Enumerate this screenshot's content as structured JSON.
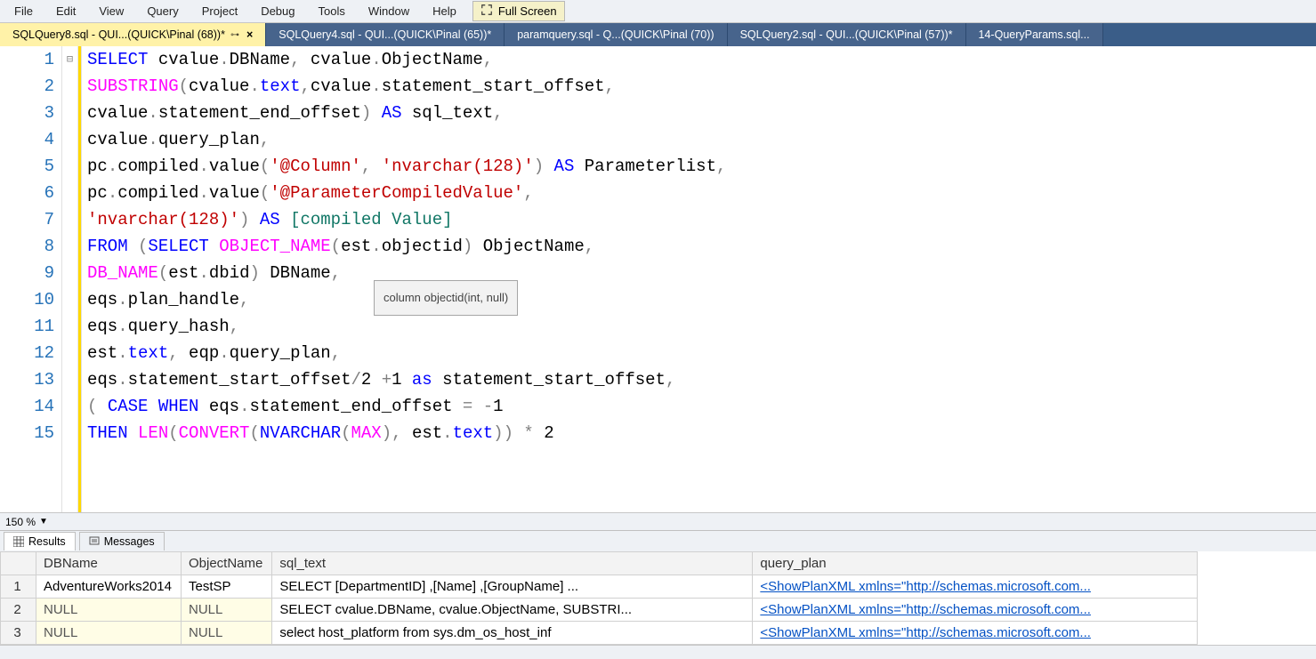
{
  "menubar": {
    "items": [
      "File",
      "Edit",
      "View",
      "Query",
      "Project",
      "Debug",
      "Tools",
      "Window",
      "Help"
    ],
    "fullscreen_label": "Full Screen"
  },
  "tabs": [
    {
      "label": "SQLQuery8.sql - QUI...(QUICK\\Pinal (68))*",
      "active": true,
      "pinned": true,
      "closable": true
    },
    {
      "label": "SQLQuery4.sql - QUI...(QUICK\\Pinal (65))*",
      "active": false,
      "pinned": false,
      "closable": false
    },
    {
      "label": "paramquery.sql - Q...(QUICK\\Pinal (70))",
      "active": false,
      "pinned": false,
      "closable": false
    },
    {
      "label": "SQLQuery2.sql - QUI...(QUICK\\Pinal (57))*",
      "active": false,
      "pinned": false,
      "closable": false
    },
    {
      "label": "14-QueryParams.sql...",
      "active": false,
      "pinned": false,
      "closable": false
    }
  ],
  "code_lines": [
    {
      "n": 1,
      "tokens": [
        {
          "t": "SELECT ",
          "c": "kw"
        },
        {
          "t": "cvalue",
          "c": "id"
        },
        {
          "t": ".",
          "c": "op"
        },
        {
          "t": "DBName",
          "c": "id"
        },
        {
          "t": ", ",
          "c": "op"
        },
        {
          "t": "cvalue",
          "c": "id"
        },
        {
          "t": ".",
          "c": "op"
        },
        {
          "t": "ObjectName",
          "c": "id"
        },
        {
          "t": ",",
          "c": "op"
        }
      ]
    },
    {
      "n": 2,
      "tokens": [
        {
          "t": "SUBSTRING",
          "c": "fn"
        },
        {
          "t": "(",
          "c": "op"
        },
        {
          "t": "cvalue",
          "c": "id"
        },
        {
          "t": ".",
          "c": "op"
        },
        {
          "t": "text",
          "c": "kw"
        },
        {
          "t": ",",
          "c": "op"
        },
        {
          "t": "cvalue",
          "c": "id"
        },
        {
          "t": ".",
          "c": "op"
        },
        {
          "t": "statement_start_offset",
          "c": "id"
        },
        {
          "t": ",",
          "c": "op"
        }
      ]
    },
    {
      "n": 3,
      "tokens": [
        {
          "t": "cvalue",
          "c": "id"
        },
        {
          "t": ".",
          "c": "op"
        },
        {
          "t": "statement_end_offset",
          "c": "id"
        },
        {
          "t": ") ",
          "c": "op"
        },
        {
          "t": "AS",
          "c": "kw"
        },
        {
          "t": " sql_text",
          "c": "id"
        },
        {
          "t": ",",
          "c": "op"
        }
      ]
    },
    {
      "n": 4,
      "tokens": [
        {
          "t": "cvalue",
          "c": "id"
        },
        {
          "t": ".",
          "c": "op"
        },
        {
          "t": "query_plan",
          "c": "id"
        },
        {
          "t": ",",
          "c": "op"
        }
      ]
    },
    {
      "n": 5,
      "tokens": [
        {
          "t": "pc",
          "c": "id"
        },
        {
          "t": ".",
          "c": "op"
        },
        {
          "t": "compiled",
          "c": "id"
        },
        {
          "t": ".",
          "c": "op"
        },
        {
          "t": "value",
          "c": "id"
        },
        {
          "t": "(",
          "c": "op"
        },
        {
          "t": "'@Column'",
          "c": "str"
        },
        {
          "t": ", ",
          "c": "op"
        },
        {
          "t": "'nvarchar(128)'",
          "c": "str"
        },
        {
          "t": ") ",
          "c": "op"
        },
        {
          "t": "AS",
          "c": "kw"
        },
        {
          "t": " Parameterlist",
          "c": "id"
        },
        {
          "t": ",",
          "c": "op"
        }
      ]
    },
    {
      "n": 6,
      "tokens": [
        {
          "t": "pc",
          "c": "id"
        },
        {
          "t": ".",
          "c": "op"
        },
        {
          "t": "compiled",
          "c": "id"
        },
        {
          "t": ".",
          "c": "op"
        },
        {
          "t": "value",
          "c": "id"
        },
        {
          "t": "(",
          "c": "op"
        },
        {
          "t": "'@ParameterCompiledValue'",
          "c": "str"
        },
        {
          "t": ",",
          "c": "op"
        }
      ]
    },
    {
      "n": 7,
      "tokens": [
        {
          "t": "'nvarchar(128)'",
          "c": "str"
        },
        {
          "t": ") ",
          "c": "op"
        },
        {
          "t": "AS",
          "c": "kw"
        },
        {
          "t": " ",
          "c": "id"
        },
        {
          "t": "[compiled Value]",
          "c": "teal"
        }
      ]
    },
    {
      "n": 8,
      "tokens": [
        {
          "t": "FROM ",
          "c": "kw"
        },
        {
          "t": "(",
          "c": "op"
        },
        {
          "t": "SELECT ",
          "c": "kw"
        },
        {
          "t": "OBJECT_NAME",
          "c": "fn"
        },
        {
          "t": "(",
          "c": "op"
        },
        {
          "t": "est",
          "c": "id"
        },
        {
          "t": ".",
          "c": "op"
        },
        {
          "t": "objectid",
          "c": "id"
        },
        {
          "t": ") ",
          "c": "op"
        },
        {
          "t": "ObjectName",
          "c": "id"
        },
        {
          "t": ",",
          "c": "op"
        }
      ]
    },
    {
      "n": 9,
      "tokens": [
        {
          "t": "DB_NAME",
          "c": "fn"
        },
        {
          "t": "(",
          "c": "op"
        },
        {
          "t": "est",
          "c": "id"
        },
        {
          "t": ".",
          "c": "op"
        },
        {
          "t": "dbid",
          "c": "id"
        },
        {
          "t": ") ",
          "c": "op"
        },
        {
          "t": "DBName",
          "c": "id"
        },
        {
          "t": ",",
          "c": "op"
        }
      ]
    },
    {
      "n": 10,
      "tokens": [
        {
          "t": "eqs",
          "c": "id"
        },
        {
          "t": ".",
          "c": "op"
        },
        {
          "t": "plan_handle",
          "c": "id"
        },
        {
          "t": ",",
          "c": "op"
        }
      ]
    },
    {
      "n": 11,
      "tokens": [
        {
          "t": "eqs",
          "c": "id"
        },
        {
          "t": ".",
          "c": "op"
        },
        {
          "t": "query_hash",
          "c": "id"
        },
        {
          "t": ",",
          "c": "op"
        }
      ]
    },
    {
      "n": 12,
      "tokens": [
        {
          "t": "est",
          "c": "id"
        },
        {
          "t": ".",
          "c": "op"
        },
        {
          "t": "text",
          "c": "kw"
        },
        {
          "t": ", ",
          "c": "op"
        },
        {
          "t": "eqp",
          "c": "id"
        },
        {
          "t": ".",
          "c": "op"
        },
        {
          "t": "query_plan",
          "c": "id"
        },
        {
          "t": ",",
          "c": "op"
        }
      ]
    },
    {
      "n": 13,
      "tokens": [
        {
          "t": "eqs",
          "c": "id"
        },
        {
          "t": ".",
          "c": "op"
        },
        {
          "t": "statement_start_offset",
          "c": "id"
        },
        {
          "t": "/",
          "c": "op"
        },
        {
          "t": "2 ",
          "c": "num"
        },
        {
          "t": "+",
          "c": "op"
        },
        {
          "t": "1 ",
          "c": "num"
        },
        {
          "t": "as",
          "c": "kw"
        },
        {
          "t": " statement_start_offset",
          "c": "id"
        },
        {
          "t": ",",
          "c": "op"
        }
      ]
    },
    {
      "n": 14,
      "tokens": [
        {
          "t": "( ",
          "c": "op"
        },
        {
          "t": "CASE WHEN ",
          "c": "kw"
        },
        {
          "t": "eqs",
          "c": "id"
        },
        {
          "t": ".",
          "c": "op"
        },
        {
          "t": "statement_end_offset ",
          "c": "id"
        },
        {
          "t": "= ",
          "c": "op"
        },
        {
          "t": "-",
          "c": "op"
        },
        {
          "t": "1",
          "c": "num"
        }
      ]
    },
    {
      "n": 15,
      "tokens": [
        {
          "t": "THEN ",
          "c": "kw"
        },
        {
          "t": "LEN",
          "c": "fn"
        },
        {
          "t": "(",
          "c": "op"
        },
        {
          "t": "CONVERT",
          "c": "fn"
        },
        {
          "t": "(",
          "c": "op"
        },
        {
          "t": "NVARCHAR",
          "c": "kw"
        },
        {
          "t": "(",
          "c": "op"
        },
        {
          "t": "MAX",
          "c": "fn"
        },
        {
          "t": ")",
          "c": "op"
        },
        {
          "t": ", ",
          "c": "op"
        },
        {
          "t": "est",
          "c": "id"
        },
        {
          "t": ".",
          "c": "op"
        },
        {
          "t": "text",
          "c": "kw"
        },
        {
          "t": ")) ",
          "c": "op"
        },
        {
          "t": "* ",
          "c": "op"
        },
        {
          "t": "2",
          "c": "num"
        }
      ]
    }
  ],
  "tooltip_text": "column objectid(int, null)",
  "zoom_label": "150 %",
  "result_tabs": {
    "results": "Results",
    "messages": "Messages"
  },
  "grid": {
    "columns": [
      "DBName",
      "ObjectName",
      "sql_text",
      "query_plan"
    ],
    "rows": [
      {
        "n": 1,
        "DBName": "AdventureWorks2014",
        "ObjectName": "TestSP",
        "sql_text": "SELECT [DepartmentID]       ,[Name]       ,[GroupName]   ...",
        "query_plan": "<ShowPlanXML xmlns=\"http://schemas.microsoft.com..."
      },
      {
        "n": 2,
        "DBName": "NULL",
        "ObjectName": "NULL",
        "sql_text": "SELECT cvalue.DBName, cvalue.ObjectName,  SUBSTRI...",
        "query_plan": "<ShowPlanXML xmlns=\"http://schemas.microsoft.com..."
      },
      {
        "n": 3,
        "DBName": "NULL",
        "ObjectName": "NULL",
        "sql_text": "select host_platform from sys.dm_os_host_inf",
        "query_plan": "<ShowPlanXML xmlns=\"http://schemas.microsoft.com..."
      }
    ]
  }
}
